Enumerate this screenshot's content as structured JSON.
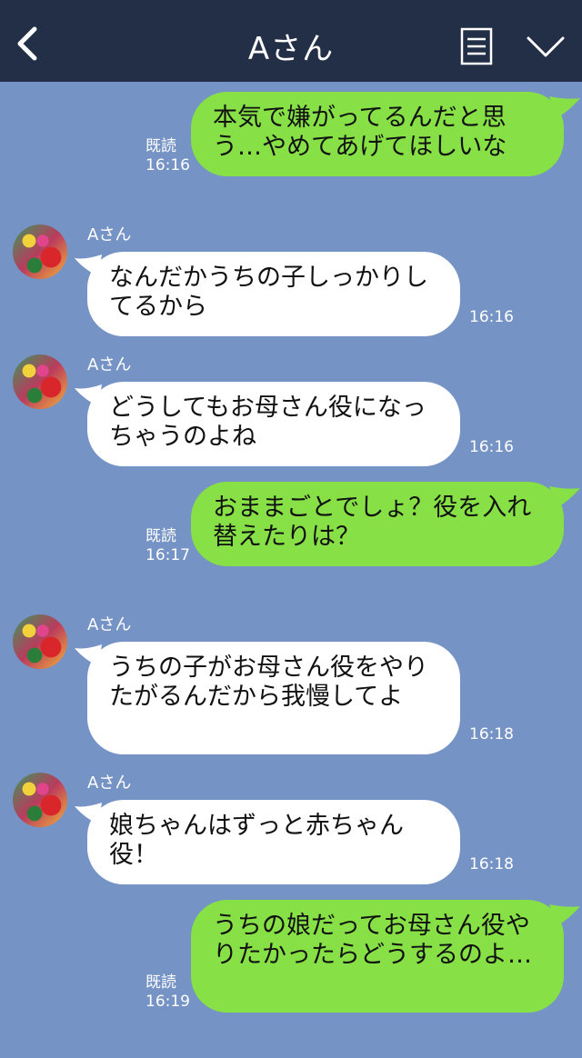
{
  "header": {
    "title": "Aさん"
  },
  "messages": [
    {
      "side": "out",
      "text": "本気で嫌がってるんだと思う…やめてあげてほしいな",
      "read": "既読",
      "time": "16:16"
    },
    {
      "side": "in",
      "sender": "Aさん",
      "text": "なんだかうちの子しっかりしてるから",
      "time": "16:16"
    },
    {
      "side": "in",
      "sender": "Aさん",
      "text": "どうしてもお母さん役になっちゃうのよね",
      "time": "16:16"
    },
    {
      "side": "out",
      "text": "おままごとでしょ？役を入れ替えたりは？",
      "read": "既読",
      "time": "16:17"
    },
    {
      "side": "in",
      "sender": "Aさん",
      "text": "うちの子がお母さん役をやりたがるんだから我慢してよ",
      "time": "16:18"
    },
    {
      "side": "in",
      "sender": "Aさん",
      "text": "娘ちゃんはずっと赤ちゃん役！",
      "time": "16:18"
    },
    {
      "side": "out",
      "text": "うちの娘だってお母さん役やりたかったらどうするのよ…",
      "read": "既読",
      "time": "16:19"
    }
  ],
  "colors": {
    "header_bg": "#232e47",
    "chat_bg": "#7593c4",
    "outgoing": "#86e046",
    "incoming": "#ffffff"
  },
  "icons": {
    "back": "chevron-left-icon",
    "menu": "list-icon",
    "collapse": "chevron-down-icon"
  }
}
